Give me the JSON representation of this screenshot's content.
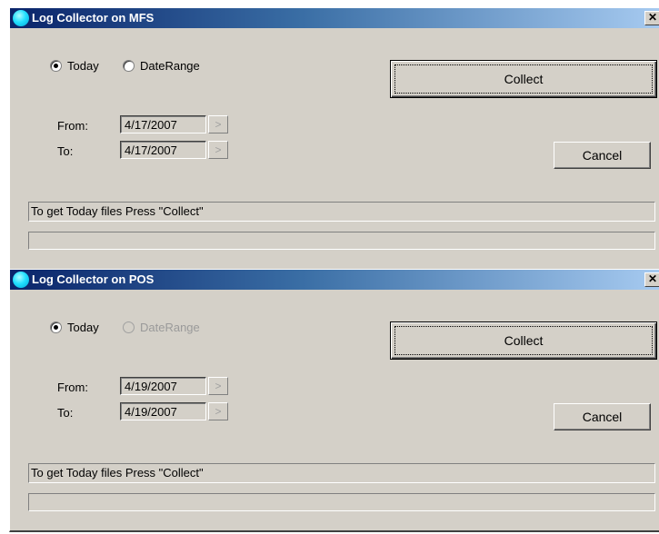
{
  "windows": [
    {
      "title": "Log Collector on MFS",
      "close_glyph": "✕",
      "radio_today": "Today",
      "radio_today_checked": true,
      "radio_daterange": "DateRange",
      "radio_daterange_enabled": true,
      "from_label": "From:",
      "from_value": "4/17/2007",
      "to_label": "To:",
      "to_value": "4/17/2007",
      "arrow_glyph": ">",
      "collect_label": "Collect",
      "cancel_label": "Cancel",
      "status_text": "To get Today files Press \"Collect\"",
      "progress": 0
    },
    {
      "title": "Log Collector on POS",
      "close_glyph": "✕",
      "radio_today": "Today",
      "radio_today_checked": true,
      "radio_daterange": "DateRange",
      "radio_daterange_enabled": false,
      "from_label": "From:",
      "from_value": "4/19/2007",
      "to_label": "To:",
      "to_value": "4/19/2007",
      "arrow_glyph": ">",
      "collect_label": "Collect",
      "cancel_label": "Cancel",
      "status_text": "To get Today files Press \"Collect\"",
      "progress": 0
    }
  ]
}
